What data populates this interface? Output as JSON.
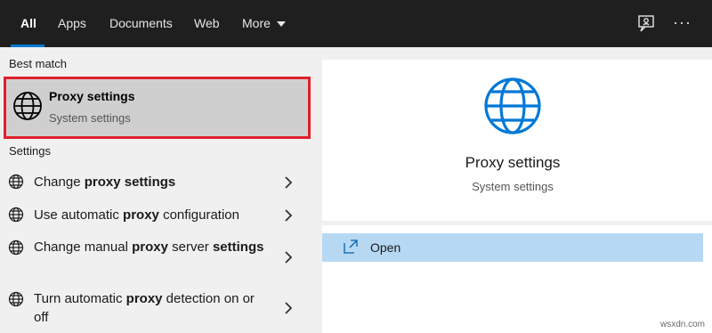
{
  "tabs": [
    {
      "label": "All",
      "active": true
    },
    {
      "label": "Apps"
    },
    {
      "label": "Documents"
    },
    {
      "label": "Web"
    },
    {
      "label": "More"
    }
  ],
  "top_icons": [
    "feedback-icon",
    "more-options-icon"
  ],
  "top_more_glyph": "···",
  "best_match": {
    "section_label": "Best match",
    "title": "Proxy settings",
    "subtitle": "System settings",
    "icon": "globe-icon",
    "highlight_color": "#e0202a"
  },
  "settings": {
    "section_label": "Settings",
    "items": [
      {
        "pre": "Change ",
        "bold": "proxy settings",
        "post": "",
        "icon": "globe-icon"
      },
      {
        "pre": "Use automatic ",
        "bold": "proxy",
        "post": " configuration",
        "icon": "globe-icon"
      },
      {
        "pre": "Change manual ",
        "bold": "proxy",
        "post": " server ",
        "bold2": "settings",
        "icon": "globe-icon"
      },
      {
        "pre": "Turn automatic ",
        "bold": "proxy",
        "post": " detection on or off",
        "icon": "globe-icon"
      }
    ]
  },
  "detail": {
    "title": "Proxy settings",
    "subtitle": "System settings",
    "icon": "globe-icon",
    "icon_color": "#0078d7",
    "actions": [
      {
        "label": "Open",
        "icon": "open-window-icon"
      }
    ]
  },
  "watermark": "wsxdn.com",
  "colors": {
    "topbar": "#1f1f1f",
    "accent": "#0078d7",
    "open_row": "#b7d8f3"
  }
}
